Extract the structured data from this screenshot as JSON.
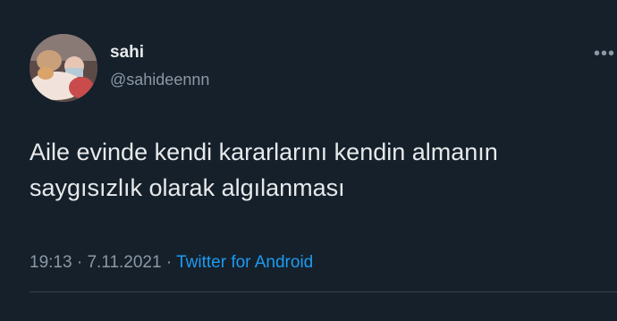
{
  "tweet": {
    "display_name": "sahi",
    "handle": "@sahideennn",
    "text": "Aile evinde kendi kararlarını kendin almanın\nsaygısızlık olarak algılanması",
    "time": "19:13",
    "separator": "·",
    "date": "7.11.2021",
    "source": "Twitter for Android"
  },
  "icons": {
    "more": "more-horizontal-icon",
    "avatar": "profile-photo"
  },
  "colors": {
    "background": "#15202b",
    "primary_text": "#e7e9ea",
    "secondary_text": "#8b98a5",
    "link": "#1d9bf0",
    "divider": "#38444d"
  }
}
